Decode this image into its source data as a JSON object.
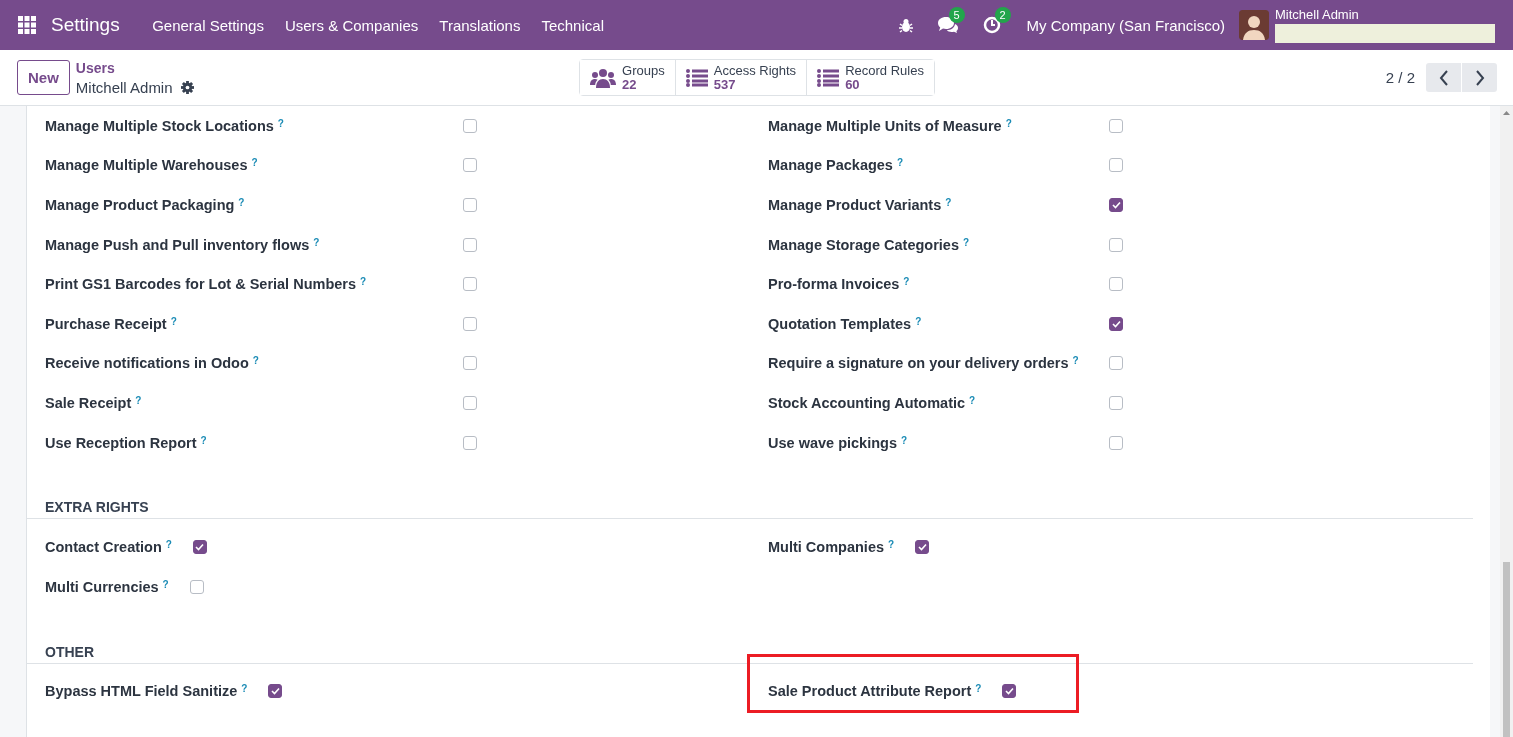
{
  "navbar": {
    "app_name": "Settings",
    "menu": [
      "General Settings",
      "Users & Companies",
      "Translations",
      "Technical"
    ],
    "messages_badge": "5",
    "activities_badge": "2",
    "company": "My Company (San Francisco)",
    "user_name": "Mitchell Admin"
  },
  "control_panel": {
    "new_button": "New",
    "breadcrumb": "Users",
    "record_name": "Mitchell Admin",
    "stat_buttons": [
      {
        "kind": "groups",
        "label": "Groups",
        "count": "22"
      },
      {
        "kind": "list",
        "label": "Access Rights",
        "count": "537"
      },
      {
        "kind": "list",
        "label": "Record Rules",
        "count": "60"
      }
    ],
    "pager": "2 / 2"
  },
  "sections": [
    {
      "kind": "aligned",
      "fields": [
        {
          "label": "Manage Multiple Stock Locations",
          "help": "?",
          "checked": false
        },
        {
          "label": "Manage Multiple Units of Measure",
          "help": "?",
          "checked": false
        },
        {
          "label": "Manage Multiple Warehouses",
          "help": "?",
          "checked": false
        },
        {
          "label": "Manage Packages",
          "help": "?",
          "checked": false
        },
        {
          "label": "Manage Product Packaging",
          "help": "?",
          "checked": false
        },
        {
          "label": "Manage Product Variants",
          "help": "?",
          "checked": true
        },
        {
          "label": "Manage Push and Pull inventory flows",
          "help": "?",
          "checked": false
        },
        {
          "label": "Manage Storage Categories",
          "help": "?",
          "checked": false
        },
        {
          "label": "Print GS1 Barcodes for Lot & Serial Numbers",
          "help": "?",
          "checked": false
        },
        {
          "label": "Pro-forma Invoices",
          "help": "?",
          "checked": false
        },
        {
          "label": "Purchase Receipt",
          "help": "?",
          "checked": false
        },
        {
          "label": "Quotation Templates",
          "help": "?",
          "checked": true
        },
        {
          "label": "Receive notifications in Odoo",
          "help": "?",
          "checked": false
        },
        {
          "label": "Require a signature on your delivery orders",
          "help": "?",
          "checked": false
        },
        {
          "label": "Sale Receipt",
          "help": "?",
          "checked": false
        },
        {
          "label": "Stock Accounting Automatic",
          "help": "?",
          "checked": false
        },
        {
          "label": "Use Reception Report",
          "help": "?",
          "checked": false
        },
        {
          "label": "Use wave pickings",
          "help": "?",
          "checked": false
        }
      ]
    },
    {
      "kind": "inline",
      "title": "EXTRA RIGHTS",
      "fields": [
        {
          "label": "Contact Creation",
          "help": "?",
          "checked": true
        },
        {
          "label": "Multi Companies",
          "help": "?",
          "checked": true
        },
        {
          "label": "Multi Currencies",
          "help": "?",
          "checked": false
        }
      ]
    },
    {
      "kind": "inline",
      "title": "OTHER",
      "fields": [
        {
          "label": "Bypass HTML Field Sanitize",
          "help": "?",
          "checked": true,
          "highlighted": false
        },
        {
          "label": "Sale Product Attribute Report",
          "help": "?",
          "checked": true,
          "highlighted": true
        }
      ]
    }
  ]
}
